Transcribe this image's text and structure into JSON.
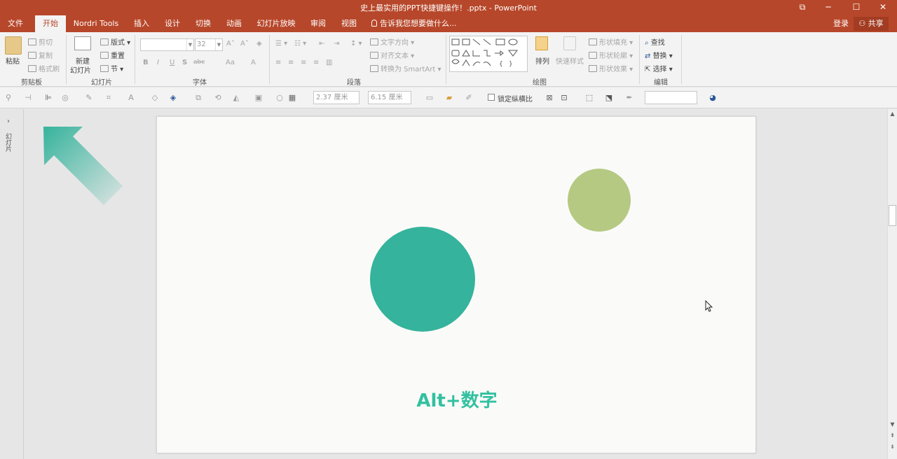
{
  "window": {
    "title": "史上最实用的PPT快捷键操作！.pptx - PowerPoint",
    "restore_glyph": "⧉",
    "minimize_glyph": "─",
    "maximize_glyph": "☐",
    "close_glyph": "✕"
  },
  "tabs": [
    {
      "label": "文件"
    },
    {
      "label": "开始"
    },
    {
      "label": "Nordri Tools"
    },
    {
      "label": "插入"
    },
    {
      "label": "设计"
    },
    {
      "label": "切换"
    },
    {
      "label": "动画"
    },
    {
      "label": "幻灯片放映"
    },
    {
      "label": "审阅"
    },
    {
      "label": "视图"
    }
  ],
  "tell_me": "告诉我您想要做什么...",
  "account": {
    "login": "登录",
    "share": "共享"
  },
  "ribbon": {
    "clipboard": {
      "paste": "粘贴",
      "cut": "剪切",
      "copy": "复制",
      "format_painter": "格式刷",
      "label": "剪贴板"
    },
    "slides": {
      "new_slide": "新建",
      "new_slide2": "幻灯片",
      "layout": "版式",
      "reset": "重置",
      "section": "节",
      "label": "幻灯片"
    },
    "font": {
      "font_size": "32",
      "label": "字体",
      "bold": "B",
      "italic": "I",
      "underline": "U",
      "shadow": "S",
      "strike": "abc",
      "case": "Aa",
      "font_color": "A"
    },
    "paragraph": {
      "text_direction": "文字方向",
      "align_text": "对齐文本",
      "smartart": "转换为 SmartArt",
      "label": "段落"
    },
    "drawing": {
      "arrange": "排列",
      "quick_styles": "快速样式",
      "shape_fill": "形状填充",
      "shape_outline": "形状轮廓",
      "shape_effects": "形状效果",
      "label": "绘图"
    },
    "editing": {
      "find": "查找",
      "replace": "替换",
      "select": "选择",
      "label": "编辑"
    }
  },
  "format_bar": {
    "height_value": "2.37 厘米",
    "width_value": "6.15 厘米",
    "lock_ratio": "锁定纵横比"
  },
  "thumb_pane": {
    "label": "幻灯片",
    "expand_glyph": "›"
  },
  "slide": {
    "shortcut_text": "Alt+数字",
    "colors": {
      "teal": "#35b39c",
      "green": "#b5c983",
      "text": "#33c0a0"
    }
  }
}
